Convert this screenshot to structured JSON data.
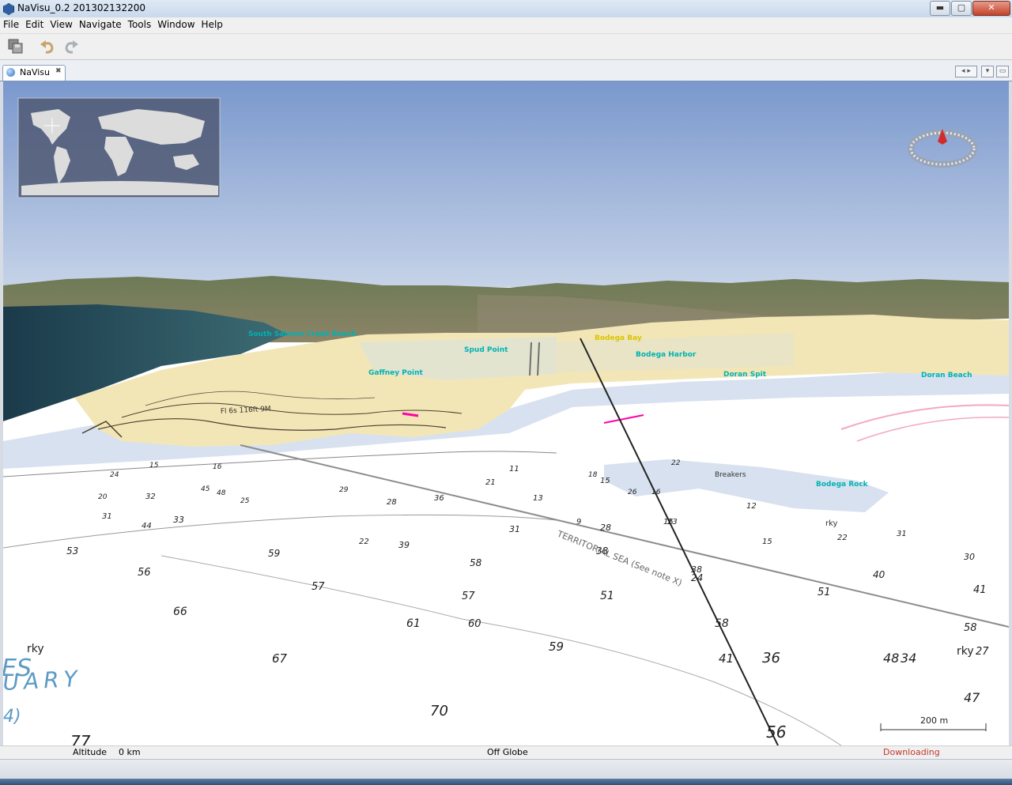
{
  "window": {
    "title": "NaVisu_0.2 201302132200"
  },
  "window_controls": {
    "minimize": "▬",
    "maximize": "▢",
    "close": "✕"
  },
  "menu": [
    "File",
    "Edit",
    "View",
    "Navigate",
    "Tools",
    "Window",
    "Help"
  ],
  "toolbar": {
    "buttons": [
      "save-all",
      "undo",
      "redo"
    ]
  },
  "tab": {
    "label": "NaVisu",
    "close": "✖"
  },
  "tab_controls": {
    "scroll": "◂ ▸",
    "dropdown": "▾",
    "maximize": "▭"
  },
  "map": {
    "place_labels": [
      "South Salmon Creek Beach",
      "Spud Point",
      "Bodega Bay",
      "Bodega Harbor",
      "Gaffney Point",
      "Doran Spit",
      "Doran Beach",
      "Bodega Rock"
    ],
    "depths": [
      "53",
      "59",
      "56",
      "57",
      "66",
      "67",
      "70",
      "77",
      "61",
      "60",
      "59",
      "58",
      "57",
      "51",
      "58",
      "41",
      "38",
      "31",
      "24",
      "27",
      "34",
      "36",
      "33",
      "39",
      "45",
      "48",
      "44",
      "31",
      "32",
      "29",
      "20",
      "16",
      "15",
      "24",
      "25",
      "22",
      "28",
      "36",
      "21",
      "11",
      "13",
      "9",
      "15",
      "15",
      "18",
      "22",
      "26",
      "16",
      "12",
      "15",
      "22",
      "31",
      "30",
      "40",
      "41",
      "51",
      "58",
      "48",
      "47",
      "56",
      "38",
      "28",
      "23"
    ],
    "annotations": [
      "rky",
      "TERRITORIAL SEA (See note X)",
      "Fl 6s 116ft 9M",
      "ES",
      "UARY",
      "4)",
      "Breakers",
      "rky",
      "rky"
    ],
    "scale_label": "200 m",
    "colors": {
      "sky_top": "#7a98cd",
      "sky_horizon": "#c6d3e8",
      "land": "#f3e6b6",
      "shallow": "#d8e1ef",
      "ocean": "#ffffff",
      "label_cyan": "#00b2b2",
      "label_yellow": "#d9c400"
    }
  },
  "status": {
    "altitude_label": "Altitude",
    "altitude_value": "0 km",
    "globe_state": "Off Globe",
    "downloading": "Downloading"
  }
}
